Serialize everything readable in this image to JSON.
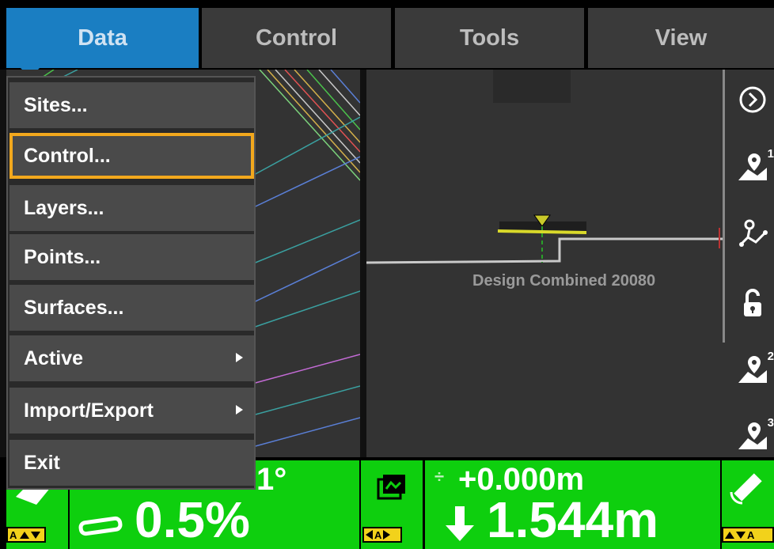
{
  "tabs": [
    {
      "label": "Data",
      "active": true
    },
    {
      "label": "Control",
      "active": false
    },
    {
      "label": "Tools",
      "active": false
    },
    {
      "label": "View",
      "active": false
    }
  ],
  "menu": {
    "items": [
      {
        "label": "Sites...",
        "submenu": false
      },
      {
        "label": "Control...",
        "submenu": false,
        "selected": true
      },
      {
        "label": "Layers...",
        "submenu": false
      },
      {
        "label": "Points...",
        "submenu": false
      },
      {
        "label": "Surfaces...",
        "submenu": false
      },
      {
        "label": "Active",
        "submenu": true
      },
      {
        "label": "Import/Export",
        "submenu": true
      },
      {
        "label": "Exit",
        "submenu": false
      }
    ]
  },
  "map": {
    "design_label": "Design Combined 20080"
  },
  "toolbar": {
    "icons": [
      "next-circle-icon",
      "map-pin-1-icon",
      "route-icon",
      "lock-open-icon",
      "map-pin-2-icon",
      "map-pin-3-icon"
    ],
    "badges": {
      "pin1": "1",
      "pin2": "2",
      "pin3": "3"
    }
  },
  "status": {
    "slope_partial": "1°",
    "cross_slope": "0.5%",
    "elevation_offset": "+0.000m",
    "cut_fill": "1.544m",
    "mode_label": "A"
  },
  "colors": {
    "accent": "#1a7ec2",
    "selection": "#f2a81d",
    "status_green": "#0ecf0e",
    "mode_yellow": "#f2d21b"
  }
}
